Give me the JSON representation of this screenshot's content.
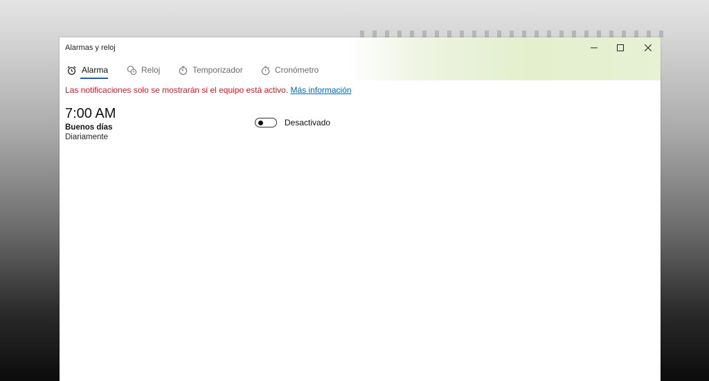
{
  "window": {
    "title": "Alarmas y reloj",
    "controls": {
      "minimize_icon": "minimize-icon",
      "maximize_icon": "maximize-icon",
      "close_icon": "close-icon"
    }
  },
  "tabs": [
    {
      "label": "Alarma",
      "icon": "alarm-clock-icon",
      "active": true
    },
    {
      "label": "Reloj",
      "icon": "world-clock-icon",
      "active": false
    },
    {
      "label": "Temporizador",
      "icon": "timer-icon",
      "active": false
    },
    {
      "label": "Cronómetro",
      "icon": "stopwatch-icon",
      "active": false
    }
  ],
  "notice": {
    "text": "Las notificaciones solo se mostrarán si el equipo está activo.",
    "link": "Más información"
  },
  "alarms": [
    {
      "time": "7:00 AM",
      "name": "Buenos días",
      "repeat": "Diariamente",
      "state_label": "Desactivado",
      "enabled": false
    }
  ],
  "colors": {
    "accent": "#0a66c2",
    "notice_text": "#e81123",
    "link": "#0067b8",
    "header_tint": "#e3efcd"
  }
}
